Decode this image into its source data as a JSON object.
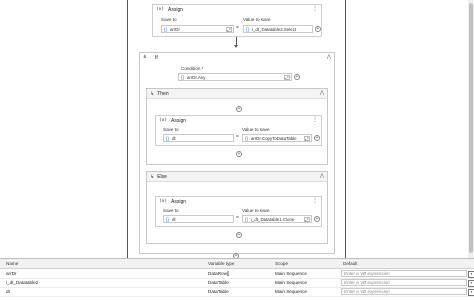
{
  "workflow": {
    "assign_top": {
      "title": "Assign",
      "save_to_label": "Save to",
      "value_label": "Value to save",
      "save_to": "arrDr",
      "value": "i_dt_Datatable2.Select"
    },
    "if_block": {
      "title": "If",
      "condition_label": "Condition *",
      "condition": "arrDr.Any"
    },
    "then": {
      "title": "Then",
      "assign": {
        "title": "Assign",
        "save_to_label": "Save to",
        "value_label": "Value to save",
        "save_to": "dt",
        "value": "arrDr.CopyToDataTable"
      }
    },
    "else": {
      "title": "Else",
      "assign": {
        "title": "Assign",
        "save_to_label": "Save to",
        "value_label": "Value to save",
        "save_to": "dt",
        "value": "i_dt_Datatable1.Clone"
      }
    }
  },
  "variables": {
    "headers": [
      "Name",
      "Variable type",
      "Scope",
      "Default"
    ],
    "rows": [
      {
        "name": "arrDr",
        "type": "DataRow[]",
        "scope": "Main Sequence",
        "default": "Enter a VB expression"
      },
      {
        "name": "i_dt_Datatable2",
        "type": "DataTable",
        "scope": "Main Sequence",
        "default": "Enter a VB expression"
      },
      {
        "name": "dt",
        "type": "DataTable",
        "scope": "Main Sequence",
        "default": "Enter a VB expression"
      }
    ]
  }
}
